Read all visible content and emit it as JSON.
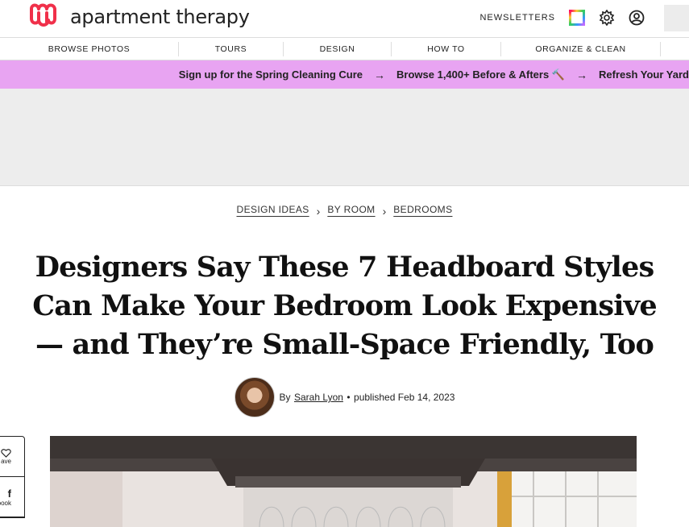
{
  "header": {
    "logo_text": "apartment therapy",
    "newsletters_label": "NEWSLETTERS",
    "icons": [
      "logo-icon",
      "rainbow-square-icon",
      "gear-icon",
      "account-icon"
    ]
  },
  "nav": {
    "items": [
      "BROWSE PHOTOS",
      "TOURS",
      "DESIGN",
      "HOW TO",
      "ORGANIZE & CLEAN"
    ]
  },
  "promo": {
    "items": [
      "Sign up for the Spring Cleaning Cure",
      "Browse 1,400+ Before & Afters 🔨",
      "Refresh Your Yard"
    ],
    "arrow": "→",
    "background": "#e8a4f2"
  },
  "breadcrumb": {
    "items": [
      "DESIGN IDEAS",
      "BY ROOM",
      "BEDROOMS"
    ],
    "separator": "›"
  },
  "article": {
    "title": "Designers Say These 7 Headboard Styles Can Make Your Bedroom Look Expensive — and They’re Small-Space Friendly, Too",
    "by_label": "By",
    "author": "Sarah Lyon",
    "separator": "•",
    "published": "published Feb 14, 2023"
  },
  "share": {
    "items": [
      {
        "icon": "heart-icon",
        "label": "ave"
      },
      {
        "icon": "facebook-icon",
        "label": "ebook"
      }
    ]
  }
}
